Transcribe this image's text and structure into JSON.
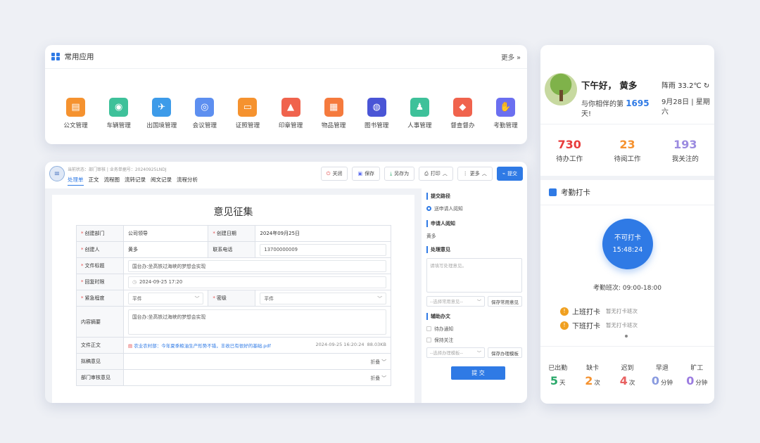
{
  "apps": {
    "title": "常用应用",
    "more": "更多 »",
    "items": [
      {
        "label": "公文管理",
        "color": "#f5922f"
      },
      {
        "label": "车辆管理",
        "color": "#3ec19a"
      },
      {
        "label": "出国境管理",
        "color": "#3d9be9"
      },
      {
        "label": "会议管理",
        "color": "#5d8ff0"
      },
      {
        "label": "证照管理",
        "color": "#f5922f"
      },
      {
        "label": "印章管理",
        "color": "#f0634d"
      },
      {
        "label": "物品管理",
        "color": "#f57a3d"
      },
      {
        "label": "图书管理",
        "color": "#4a55d6"
      },
      {
        "label": "人事管理",
        "color": "#3ec19a"
      },
      {
        "label": "督查督办",
        "color": "#f0634d"
      },
      {
        "label": "考勤管理",
        "color": "#6b6ff0"
      }
    ]
  },
  "form": {
    "meta": "当前状态：部门审核  |  业务单据号：20240925LNDJ",
    "tabs": [
      "处理单",
      "正文",
      "流程图",
      "流转记录",
      "阅文记录",
      "流程分析"
    ],
    "buttons": {
      "close": "关闭",
      "save": "保存",
      "save_as": "另存为",
      "print": "打印",
      "more": "更多",
      "submit": "提交"
    },
    "title": "意见征集",
    "fields": {
      "dept_label": "创建部门",
      "dept_value": "公司领导",
      "date_label": "创建日期",
      "date_value": "2024年09月25日",
      "creator_label": "创建人",
      "creator_value": "黄多",
      "phone_label": "联系电话",
      "phone_value": "13700000009",
      "subject_label": "文件标题",
      "subject_value": "国台办:坐高铁过海峡的梦想会实现",
      "deadline_label": "回复时限",
      "deadline_value": "2024-09-25 17:20",
      "urgency_label": "紧急程度",
      "urgency_value": "平件",
      "secret_label": "密级",
      "secret_value": "平件",
      "summary_label": "内容摘要",
      "summary_value": "国台办:坐高铁过海峡的梦想会实现",
      "attach_label": "文件正文",
      "attach_name": "农业农村部：今年夏季粮油生产形势不错，丰收已有很好的基础.pdf",
      "attach_time": "2024-09-25 16:20:24",
      "attach_size": "88.03KB",
      "draft_label": "拟稿意见",
      "dept_review_label": "部门审核意见",
      "fold": "折叠"
    }
  },
  "side": {
    "route_title": "提交路径",
    "route_option": "送申请人阅知",
    "reader_title": "申请人阅知",
    "reader_name": "黄多",
    "opinion_title": "处理意见",
    "opinion_placeholder": "请填写处理意见。",
    "common_select": "--选择常用意见--",
    "save_common": "保存常用意见",
    "assist_title": "辅助办文",
    "notify": "待办通知",
    "follow": "保持关注",
    "template_select": "--选择办理模板--",
    "save_template": "保存办理模板",
    "submit": "提 交"
  },
  "right": {
    "greeting": "下午好， 黄多",
    "weather": "阵雨 33.2℃",
    "days_prefix": "与你相伴的第",
    "days_value": "1695",
    "days_suffix": "天!",
    "date": "9月28日 | 星期六",
    "stats": [
      {
        "value": "730",
        "label": "待办工作",
        "color": "#e83d3d"
      },
      {
        "value": "23",
        "label": "待阅工作",
        "color": "#f5922f"
      },
      {
        "value": "193",
        "label": "我关注的",
        "color": "#9b8be0"
      }
    ],
    "attendance_title": "考勤打卡",
    "clock_status": "不可打卡",
    "clock_time": "15:48:24",
    "shift": "考勤班次:    09:00-18:00",
    "checkin": "上班打卡",
    "checkin_note": "暂无打卡班次",
    "checkout": "下班打卡",
    "checkout_note": "暂无打卡班次",
    "att_stats": [
      {
        "label": "已出勤",
        "value": "5",
        "unit": "天",
        "color": "#2aa86a"
      },
      {
        "label": "缺卡",
        "value": "2",
        "unit": "次",
        "color": "#f5922f"
      },
      {
        "label": "迟到",
        "value": "4",
        "unit": "次",
        "color": "#e86060"
      },
      {
        "label": "早退",
        "value": "0",
        "unit": "分钟",
        "color": "#8a9be0"
      },
      {
        "label": "旷工",
        "value": "0",
        "unit": "分钟",
        "color": "#9b7be0"
      }
    ]
  }
}
